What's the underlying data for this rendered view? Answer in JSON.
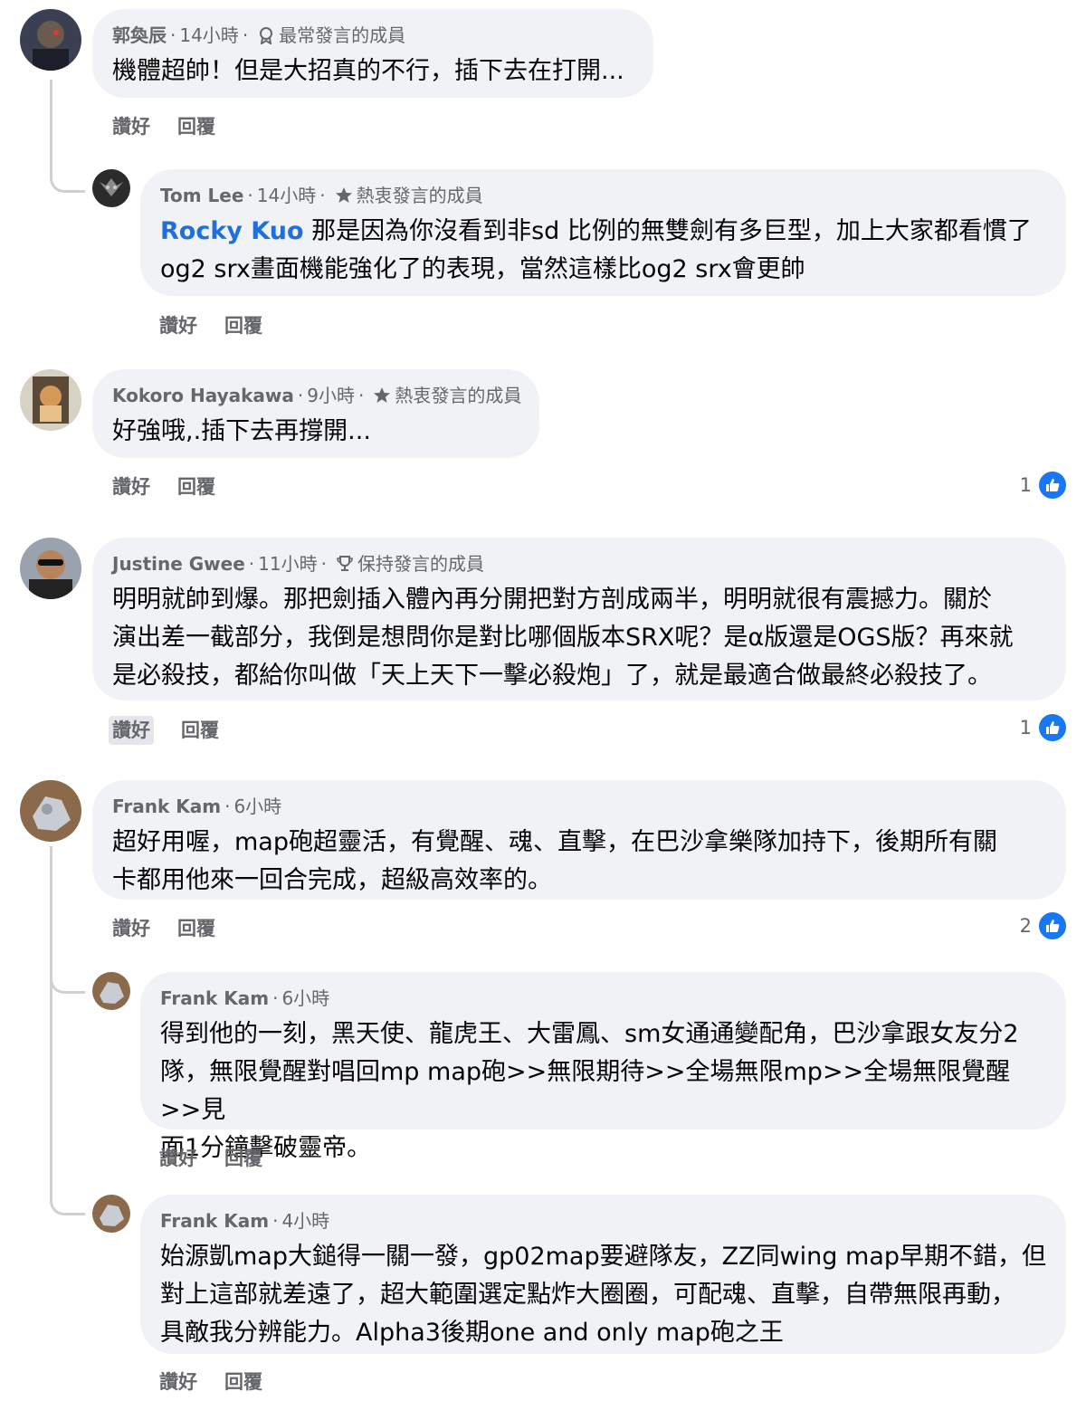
{
  "comments": [
    {
      "author": "郭奐辰",
      "time": "14小時",
      "badge": "最常發言的成員",
      "badge_icon": "rising-member-icon",
      "text": "機體超帥！但是大招真的不行，插下去在打開...",
      "like_label": "讚好",
      "reply_label": "回覆"
    },
    {
      "author": "Tom Lee",
      "time": "14小時",
      "badge": "熱衷發言的成員",
      "badge_icon": "star-icon",
      "mention": "Rocky Kuo",
      "text_line1": " 那是因為你沒看到非sd 比例的無雙劍有多巨型，加上大家都看慣了",
      "text_line2": "og2 srx畫面機能強化了的表現，當然這樣比og2 srx會更帥",
      "like_label": "讚好",
      "reply_label": "回覆"
    },
    {
      "author": "Kokoro Hayakawa",
      "time": "9小時",
      "badge": "熱衷發言的成員",
      "badge_icon": "star-icon",
      "text": "好強哦,.插下去再撐開...",
      "like_label": "讚好",
      "reply_label": "回覆",
      "reaction_count": "1"
    },
    {
      "author": "Justine Gwee",
      "time": "11小時",
      "badge": "保持發言的成員",
      "badge_icon": "trophy-icon",
      "text_line1": "明明就帥到爆。那把劍插入體內再分開把對方剖成兩半，明明就很有震撼力。關於",
      "text_line2": "演出差一截部分，我倒是想問你是對比哪個版本SRX呢？是α版還是OGS版？再來就",
      "text_line3": "是必殺技，都給你叫做「天上天下一擊必殺炮」了，就是最適合做最終必殺技了。",
      "like_label": "讚好",
      "reply_label": "回覆",
      "reaction_count": "1"
    },
    {
      "author": "Frank Kam",
      "time": "6小時",
      "text_line1": "超好用喔，map砲超靈活，有覺醒、魂、直擊，在巴沙拿樂隊加持下，後期所有關",
      "text_line2": "卡都用他來一回合完成，超級高效率的。",
      "like_label": "讚好",
      "reply_label": "回覆",
      "reaction_count": "2"
    },
    {
      "author": "Frank Kam",
      "time": "6小時",
      "text_line1": "得到他的一刻，黑天使、龍虎王、大雷鳳、sm女通通變配角，巴沙拿跟女友分2",
      "text_line2": "隊，無限覺醒對唱回mp map砲>>無限期待>>全場無限mp>>全場無限覺醒>>見",
      "text_line3": "面1分鐘擊破靈帝。",
      "like_label": "讚好",
      "reply_label": "回覆"
    },
    {
      "author": "Frank Kam",
      "time": "4小時",
      "text_line1": "始源凱map大鎚得一關一發，gp02map要避隊友，ZZ同wing map早期不錯，但",
      "text_line2": "對上這部就差遠了，超大範圍選定點炸大圈圈，可配魂、直擊，自帶無限再動，",
      "text_line3": "具敵我分辨能力。Alpha3後期one and only map砲之王",
      "like_label": "讚好",
      "reply_label": "回覆"
    }
  ],
  "colors": {
    "bubble": "#f0f2f5",
    "meta": "#65676b",
    "mention": "#216fdb",
    "like_blue": "#1877f2"
  }
}
